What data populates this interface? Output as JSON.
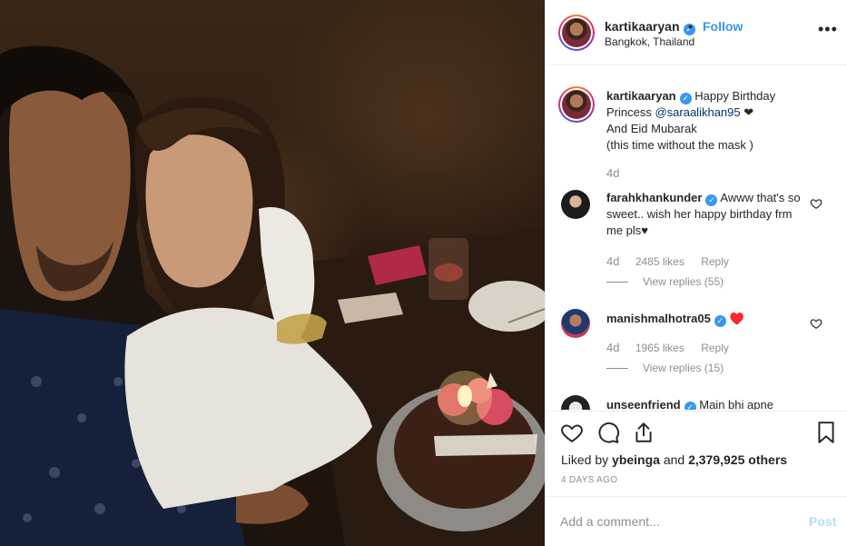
{
  "post": {
    "username": "kartikaaryan",
    "verified": true,
    "separator": "•",
    "follow_label": "Follow",
    "location": "Bangkok, Thailand",
    "more_icon": "more-horizontal-icon",
    "more_label": "•••"
  },
  "caption": {
    "username": "kartikaaryan",
    "text_1": "Happy Birthday",
    "text_2": "Princess ",
    "mention": "@saraalikhan95",
    "text_3": " ❤",
    "text_4": "And Eid Mubarak",
    "text_5": "(this time without the mask )",
    "time": "4d"
  },
  "comments": [
    {
      "username": "farahkhankunder",
      "verified": true,
      "text": "Awww that's so sweet.. wish her happy birthday frm me pls♥",
      "time": "4d",
      "likes": "2485 likes",
      "reply_label": "Reply",
      "replies": "View replies (55)"
    },
    {
      "username": "manishmalhotra05",
      "verified": true,
      "text": "♥️",
      "time": "4d",
      "likes": "1965 likes",
      "reply_label": "Reply",
      "replies": "View replies (15)"
    },
    {
      "username": "unseenfriend",
      "verified": true,
      "text": "Main bhi apne",
      "time": "",
      "likes": "",
      "reply_label": "",
      "replies": ""
    }
  ],
  "actions": {
    "icons": [
      "heart-icon",
      "comment-icon",
      "share-icon",
      "bookmark-icon"
    ],
    "liked_by_prefix": "Liked by ",
    "liked_by_user": "ybeinga",
    "liked_by_middle": " and ",
    "liked_by_count": "2,379,925 others",
    "date": "4 DAYS AGO"
  },
  "add_comment": {
    "placeholder": "Add a comment...",
    "post_label": "Post"
  },
  "colors": {
    "link_blue": "#3897f0",
    "post_disabled": "#b2dffc",
    "muted": "#8e8e8e",
    "text": "#262626"
  }
}
